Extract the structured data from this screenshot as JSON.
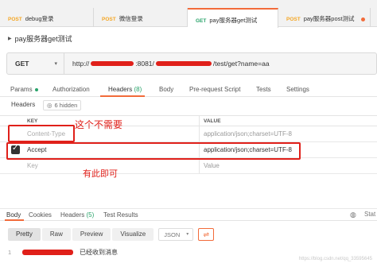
{
  "tabs": [
    {
      "method": "POST",
      "label": "debug登录"
    },
    {
      "method": "POST",
      "label": "微信登录"
    },
    {
      "method": "GET",
      "label": "pay服务器get测试"
    },
    {
      "method": "POST",
      "label": "pay服务器post测试"
    }
  ],
  "request": {
    "name": "pay服务器get测试",
    "method": "GET",
    "url_prefix": "http://",
    "url_mid": ":8081/",
    "url_suffix": "/test/get?name=aa"
  },
  "request_tabs": {
    "params": "Params",
    "authorization": "Authorization",
    "headers": "Headers",
    "headers_count": "(8)",
    "body": "Body",
    "prerequest": "Pre-request Script",
    "tests": "Tests",
    "settings": "Settings"
  },
  "headers_bar": {
    "label": "Headers",
    "hidden": "6 hidden"
  },
  "table": {
    "key_header": "KEY",
    "value_header": "VALUE",
    "rows": [
      {
        "key": "Content-Type",
        "value": "application/json;charset=UTF-8",
        "checked": false
      },
      {
        "key": "Accept",
        "value": "application/json;charset=UTF-8",
        "checked": true
      },
      {
        "key": "Key",
        "value": "Value",
        "checked": false
      }
    ]
  },
  "annotations": {
    "not_needed": "这个不需要",
    "this_is_enough": "有此即可"
  },
  "response": {
    "tabs": {
      "body": "Body",
      "cookies": "Cookies",
      "headers": "Headers",
      "headers_count": "(5)",
      "test_results": "Test Results"
    },
    "status_cut": "Stat",
    "view_buttons": [
      "Pretty",
      "Raw",
      "Preview",
      "Visualize"
    ],
    "format": "JSON",
    "line_number": "1",
    "body_text": "已经收到消息"
  },
  "watermark": "https://blog.csdn.net/qq_33595645",
  "colors": {
    "accent": "#f26b3a",
    "get": "#29a36a",
    "post": "#f5a623",
    "annotation": "#e0201a"
  }
}
